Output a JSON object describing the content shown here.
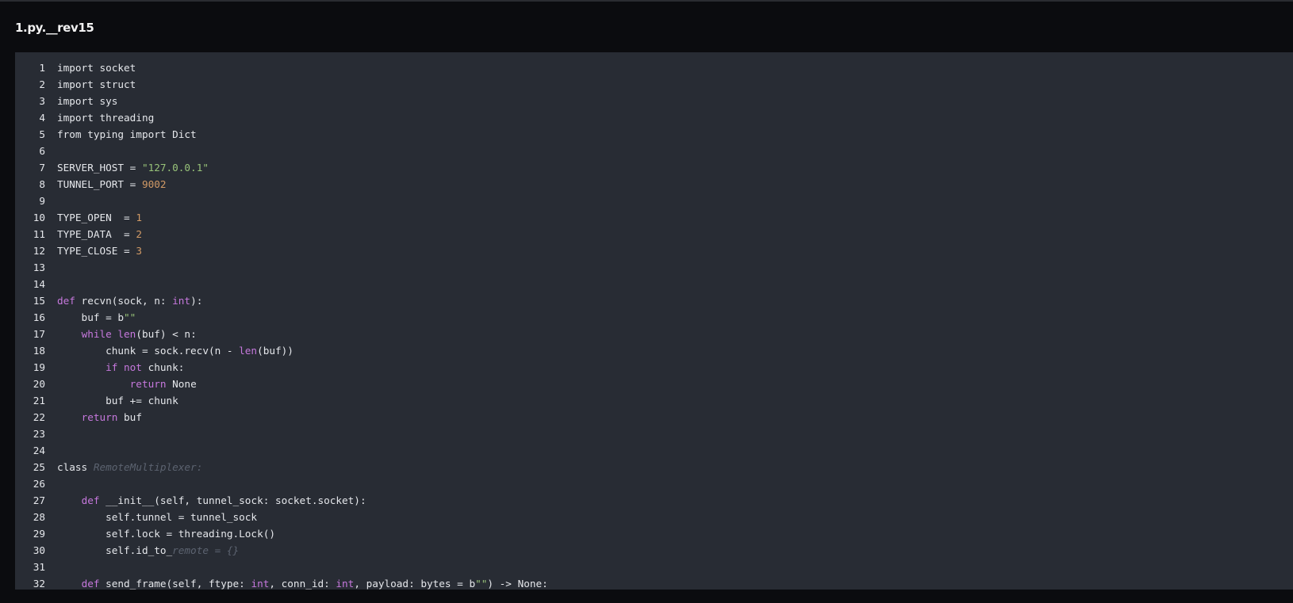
{
  "window": {
    "title": "1.py.__rev15"
  },
  "colors": {
    "page_background": "#0b0c0f",
    "editor_background": "#282c34",
    "keyword": "#c678dd",
    "string": "#98c379",
    "number": "#d19a66",
    "comment": "#5c6370",
    "text": "#e5e7eb"
  },
  "code": {
    "lines": [
      {
        "n": "1",
        "tokens": [
          {
            "t": "import socket",
            "c": ""
          }
        ]
      },
      {
        "n": "2",
        "tokens": [
          {
            "t": "import struct",
            "c": ""
          }
        ]
      },
      {
        "n": "3",
        "tokens": [
          {
            "t": "import sys",
            "c": ""
          }
        ]
      },
      {
        "n": "4",
        "tokens": [
          {
            "t": "import threading",
            "c": ""
          }
        ]
      },
      {
        "n": "5",
        "tokens": [
          {
            "t": "from typing import Dict",
            "c": ""
          }
        ]
      },
      {
        "n": "6",
        "tokens": []
      },
      {
        "n": "7",
        "tokens": [
          {
            "t": "SERVER_HOST = ",
            "c": ""
          },
          {
            "t": "\"127.0.0.1\"",
            "c": "str"
          }
        ]
      },
      {
        "n": "8",
        "tokens": [
          {
            "t": "TUNNEL_PORT = ",
            "c": ""
          },
          {
            "t": "9002",
            "c": "num"
          }
        ]
      },
      {
        "n": "9",
        "tokens": []
      },
      {
        "n": "10",
        "tokens": [
          {
            "t": "TYPE_OPEN  = ",
            "c": ""
          },
          {
            "t": "1",
            "c": "num"
          }
        ]
      },
      {
        "n": "11",
        "tokens": [
          {
            "t": "TYPE_DATA  = ",
            "c": ""
          },
          {
            "t": "2",
            "c": "num"
          }
        ]
      },
      {
        "n": "12",
        "tokens": [
          {
            "t": "TYPE_CLOSE = ",
            "c": ""
          },
          {
            "t": "3",
            "c": "num"
          }
        ]
      },
      {
        "n": "13",
        "tokens": []
      },
      {
        "n": "14",
        "tokens": []
      },
      {
        "n": "15",
        "tokens": [
          {
            "t": "def",
            "c": "kw"
          },
          {
            "t": " recvn(sock, n: ",
            "c": ""
          },
          {
            "t": "int",
            "c": "kw"
          },
          {
            "t": "):",
            "c": ""
          }
        ]
      },
      {
        "n": "16",
        "tokens": [
          {
            "t": "    buf = b",
            "c": ""
          },
          {
            "t": "\"\"",
            "c": "str"
          }
        ]
      },
      {
        "n": "17",
        "tokens": [
          {
            "t": "    ",
            "c": ""
          },
          {
            "t": "while",
            "c": "kw"
          },
          {
            "t": " ",
            "c": ""
          },
          {
            "t": "len",
            "c": "kw"
          },
          {
            "t": "(buf) < n:",
            "c": ""
          }
        ]
      },
      {
        "n": "18",
        "tokens": [
          {
            "t": "        chunk = sock.recv(n - ",
            "c": ""
          },
          {
            "t": "len",
            "c": "kw"
          },
          {
            "t": "(buf))",
            "c": ""
          }
        ]
      },
      {
        "n": "19",
        "tokens": [
          {
            "t": "        ",
            "c": ""
          },
          {
            "t": "if",
            "c": "kw"
          },
          {
            "t": " ",
            "c": ""
          },
          {
            "t": "not",
            "c": "kw"
          },
          {
            "t": " chunk:",
            "c": ""
          }
        ]
      },
      {
        "n": "20",
        "tokens": [
          {
            "t": "            ",
            "c": ""
          },
          {
            "t": "return",
            "c": "kw"
          },
          {
            "t": " None",
            "c": ""
          }
        ]
      },
      {
        "n": "21",
        "tokens": [
          {
            "t": "        buf += chunk",
            "c": ""
          }
        ]
      },
      {
        "n": "22",
        "tokens": [
          {
            "t": "    ",
            "c": ""
          },
          {
            "t": "return",
            "c": "kw"
          },
          {
            "t": " buf",
            "c": ""
          }
        ]
      },
      {
        "n": "23",
        "tokens": []
      },
      {
        "n": "24",
        "tokens": []
      },
      {
        "n": "25",
        "tokens": [
          {
            "t": "class ",
            "c": ""
          },
          {
            "t": "RemoteMultiplexer:",
            "c": "cmt"
          }
        ]
      },
      {
        "n": "26",
        "tokens": []
      },
      {
        "n": "27",
        "tokens": [
          {
            "t": "    ",
            "c": ""
          },
          {
            "t": "def",
            "c": "kw"
          },
          {
            "t": " __init__(self, tunnel_sock: socket.socket):",
            "c": ""
          }
        ]
      },
      {
        "n": "28",
        "tokens": [
          {
            "t": "        self.tunnel = tunnel_sock",
            "c": ""
          }
        ]
      },
      {
        "n": "29",
        "tokens": [
          {
            "t": "        self.lock = threading.Lock()",
            "c": ""
          }
        ]
      },
      {
        "n": "30",
        "tokens": [
          {
            "t": "        self.id_to_",
            "c": ""
          },
          {
            "t": "remote = {}",
            "c": "cmt"
          }
        ]
      },
      {
        "n": "31",
        "tokens": []
      },
      {
        "n": "32",
        "tokens": [
          {
            "t": "    ",
            "c": ""
          },
          {
            "t": "def",
            "c": "kw"
          },
          {
            "t": " send_frame(self, ftype: ",
            "c": ""
          },
          {
            "t": "int",
            "c": "kw"
          },
          {
            "t": ", conn_id: ",
            "c": ""
          },
          {
            "t": "int",
            "c": "kw"
          },
          {
            "t": ", payload: bytes = b",
            "c": ""
          },
          {
            "t": "\"\"",
            "c": "str"
          },
          {
            "t": ") -> None:",
            "c": ""
          }
        ]
      }
    ]
  }
}
